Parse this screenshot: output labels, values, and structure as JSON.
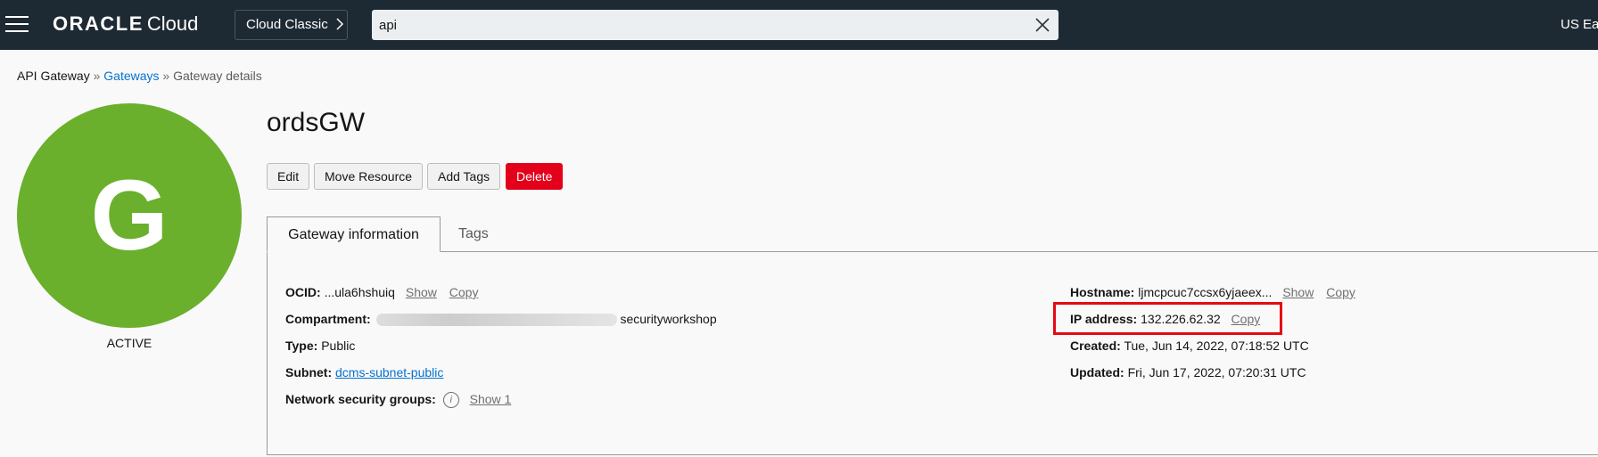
{
  "header": {
    "logo_brand": "ORACLE",
    "logo_product": "Cloud",
    "classic_button": "Cloud Classic",
    "search_value": "api",
    "region": "US Ea"
  },
  "breadcrumb": {
    "root": "API Gateway",
    "sep1": "»",
    "gateways": "Gateways",
    "sep2": "»",
    "current": "Gateway details"
  },
  "resource": {
    "avatar_letter": "G",
    "status": "ACTIVE",
    "title": "ordsGW"
  },
  "actions": {
    "edit": "Edit",
    "move": "Move Resource",
    "add_tags": "Add Tags",
    "delete": "Delete"
  },
  "tabs": {
    "info": "Gateway information",
    "tags": "Tags"
  },
  "details_left": {
    "ocid_label": "OCID:",
    "ocid_value": "...ula6hshuiq",
    "show": "Show",
    "copy": "Copy",
    "compartment_label": "Compartment:",
    "compartment_value": "securityworkshop",
    "type_label": "Type:",
    "type_value": "Public",
    "subnet_label": "Subnet:",
    "subnet_value": "dcms-subnet-public",
    "nsg_label": "Network security groups:",
    "nsg_info": "i",
    "nsg_show": "Show 1"
  },
  "details_right": {
    "hostname_label": "Hostname:",
    "hostname_value": "ljmcpcuc7ccsx6yjaeex...",
    "show": "Show",
    "copy": "Copy",
    "ip_label": "IP address:",
    "ip_value": "132.226.62.32",
    "ip_copy": "Copy",
    "created_label": "Created:",
    "created_value": "Tue, Jun 14, 2022, 07:18:52 UTC",
    "updated_label": "Updated:",
    "updated_value": "Fri, Jun 17, 2022, 07:20:31 UTC"
  },
  "colors": {
    "topbar": "#1e2a33",
    "avatar": "#6ab02c",
    "delete": "#e3001b",
    "link": "#0572ce",
    "highlight": "#e50a12"
  }
}
